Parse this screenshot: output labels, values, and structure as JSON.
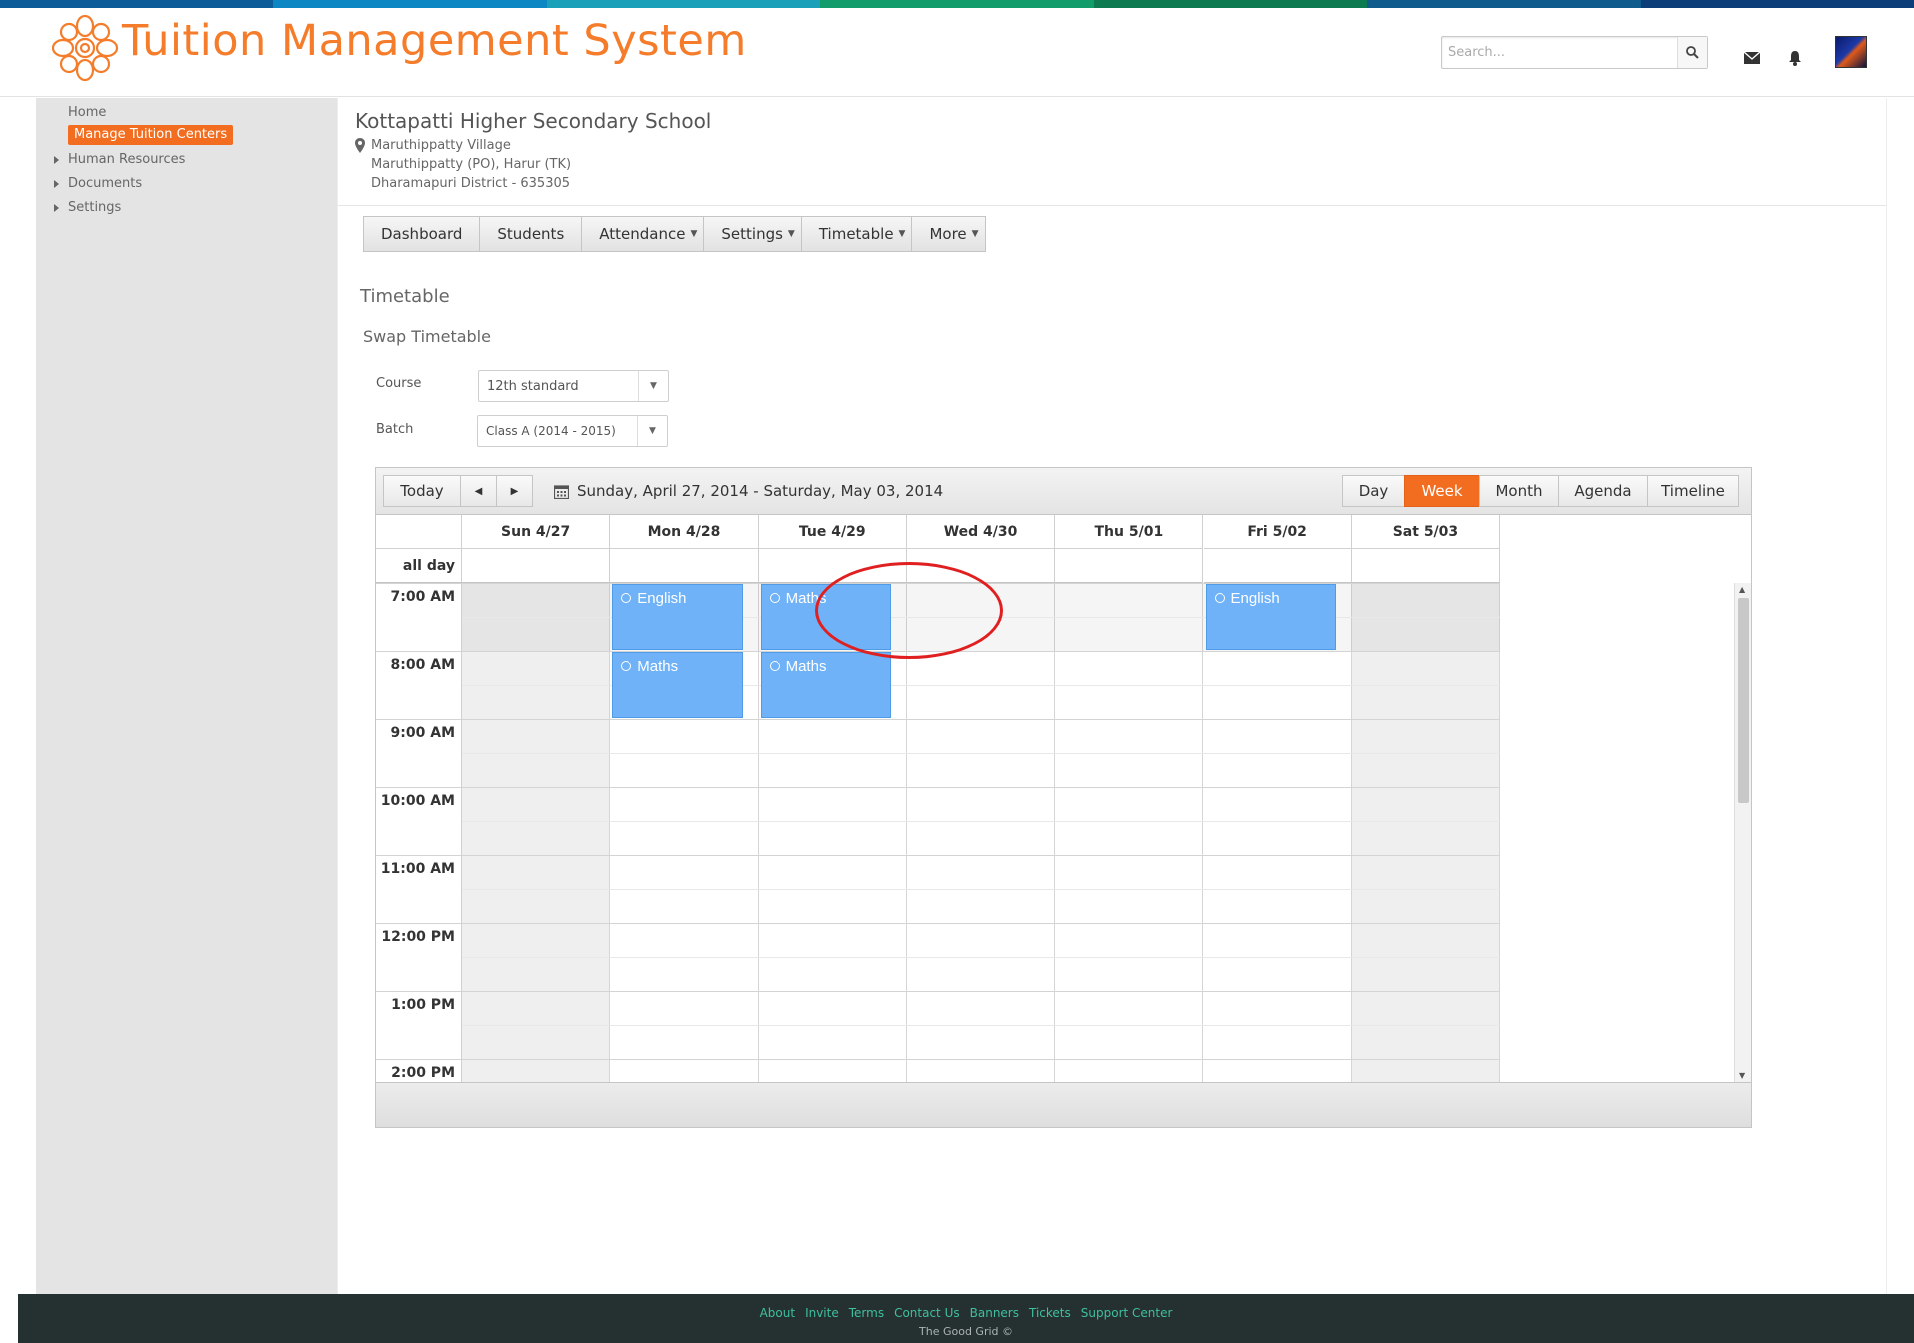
{
  "colors": {
    "brand_orange": "#f47c2a",
    "active_orange": "#f26d1f",
    "event_blue": "#6fb2f7",
    "footer_bg": "#253130",
    "footer_link": "#3fbfa0",
    "annotation_red": "#e02020",
    "top_strip": [
      "#0b5c99",
      "#0c87c4",
      "#1aa0b8",
      "#129b6b",
      "#0d7a4f",
      "#0f5c8c",
      "#0c3f7a"
    ]
  },
  "header": {
    "title": "Tuition Management System",
    "search_placeholder": "Search...",
    "icons": [
      "search-icon",
      "mail-icon",
      "bell-icon",
      "avatar"
    ]
  },
  "sidebar": {
    "items": [
      {
        "label": "Home",
        "active": false,
        "expandable": false
      },
      {
        "label": "Manage Tuition  Centers",
        "active": true,
        "expandable": false
      },
      {
        "label": "Human Resources",
        "active": false,
        "expandable": true
      },
      {
        "label": "Documents",
        "active": false,
        "expandable": true
      },
      {
        "label": "Settings",
        "active": false,
        "expandable": true
      }
    ]
  },
  "school": {
    "name": "Kottapatti Higher Secondary School",
    "address": [
      "Maruthippatty Village",
      "Maruthippatty (PO), Harur (TK)",
      "Dharamapuri District - 635305"
    ]
  },
  "tabs": [
    {
      "label": "Dashboard",
      "dropdown": false
    },
    {
      "label": "Students",
      "dropdown": false
    },
    {
      "label": "Attendance",
      "dropdown": true
    },
    {
      "label": "Settings",
      "dropdown": true
    },
    {
      "label": "Timetable",
      "dropdown": true
    },
    {
      "label": "More",
      "dropdown": true
    }
  ],
  "page": {
    "title": "Timetable",
    "subtitle": "Swap Timetable",
    "course_label": "Course",
    "course_value": "12th standard",
    "batch_label": "Batch",
    "batch_value": "Class A (2014 - 2015)"
  },
  "scheduler": {
    "today_label": "Today",
    "prev_icon": "chevron-left-icon",
    "next_icon": "chevron-right-icon",
    "date_range": "Sunday, April 27, 2014 - Saturday, May 03, 2014",
    "views": [
      {
        "label": "Day",
        "active": false
      },
      {
        "label": "Week",
        "active": true
      },
      {
        "label": "Month",
        "active": false
      },
      {
        "label": "Agenda",
        "active": false
      },
      {
        "label": "Timeline",
        "active": false
      }
    ],
    "days": [
      "Sun 4/27",
      "Mon 4/28",
      "Tue 4/29",
      "Wed 4/30",
      "Thu 5/01",
      "Fri 5/02",
      "Sat 5/03"
    ],
    "all_day_label": "all day",
    "times": [
      "7:00 AM",
      "8:00 AM",
      "9:00 AM",
      "10:00 AM",
      "11:00 AM",
      "12:00 PM",
      "1:00 PM",
      "2:00 PM"
    ],
    "events": [
      {
        "title": "English",
        "day": "Mon 4/28",
        "start": "7:00 AM",
        "end": "8:00 AM",
        "recurring": true
      },
      {
        "title": "Maths",
        "day": "Mon 4/28",
        "start": "8:00 AM",
        "end": "9:00 AM",
        "recurring": true
      },
      {
        "title": "Maths",
        "day": "Tue 4/29",
        "start": "7:00 AM",
        "end": "8:00 AM",
        "recurring": true,
        "highlighted": true
      },
      {
        "title": "Maths",
        "day": "Tue 4/29",
        "start": "8:00 AM",
        "end": "9:00 AM",
        "recurring": true
      },
      {
        "title": "English",
        "day": "Fri 5/02",
        "start": "7:00 AM",
        "end": "8:00 AM",
        "recurring": true
      }
    ]
  },
  "footer": {
    "links": [
      "About",
      "Invite",
      "Terms",
      "Contact Us",
      "Banners",
      "Tickets",
      "Support Center"
    ],
    "copyright": "The Good Grid ©"
  }
}
